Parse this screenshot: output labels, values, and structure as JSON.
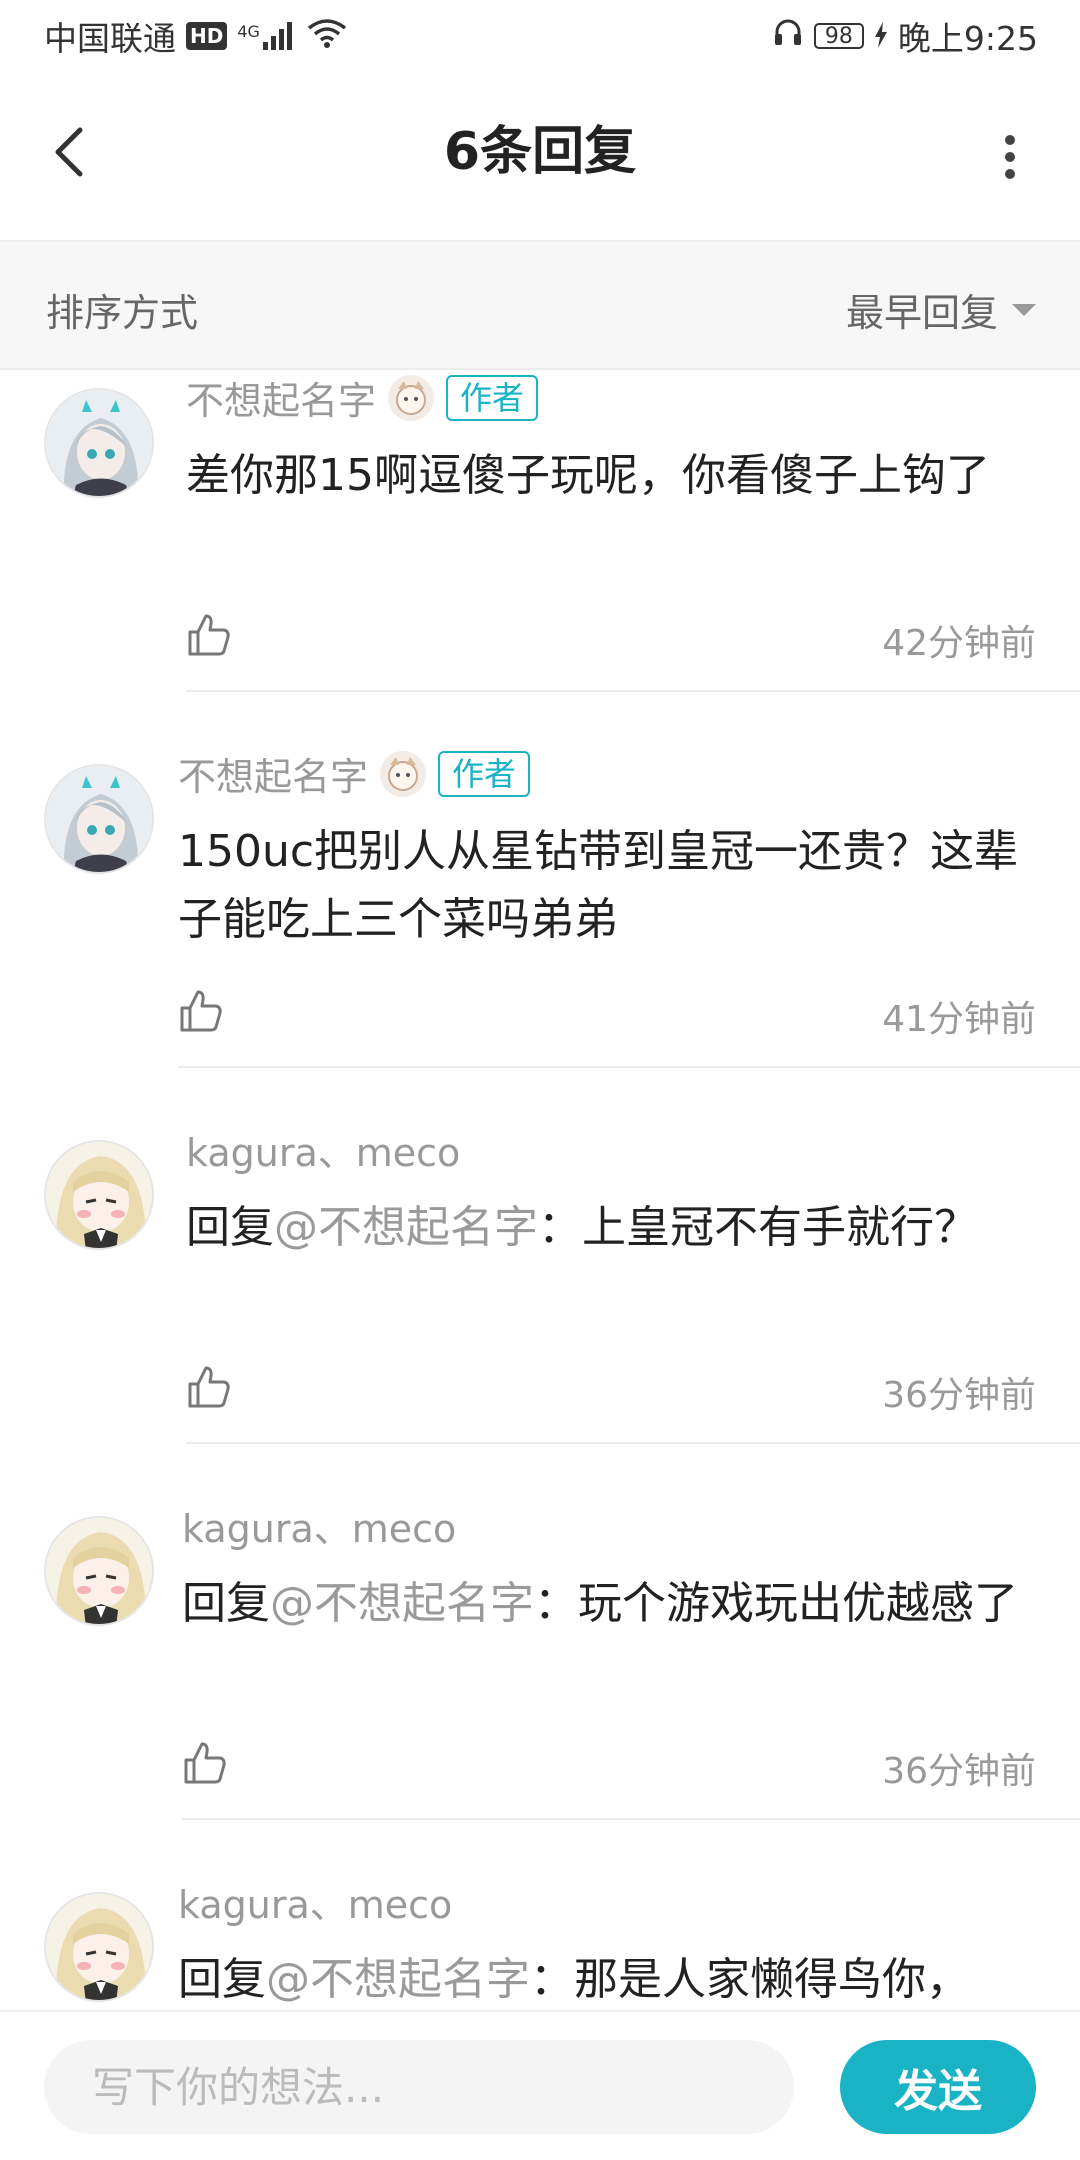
{
  "status_bar": {
    "carrier": "中国联通",
    "hd": "HD",
    "network": "4G",
    "battery": "98",
    "time": "晚上9:25"
  },
  "header": {
    "title": "6条回复",
    "back_icon": "chevron-left-icon",
    "more_icon": "more-vertical-icon"
  },
  "sort": {
    "label": "排序方式",
    "selected": "最早回复"
  },
  "comments": [
    {
      "user": "不想起名字",
      "author_tag": "作者",
      "text": "差你那15啊逗傻子玩呢，你看傻子上钩了",
      "time": "42分钟前"
    },
    {
      "user": "不想起名字",
      "author_tag": "作者",
      "text": "150uc把别人从星钻带到皇冠一还贵？这辈子能吃上三个菜吗弟弟",
      "time": "41分钟前"
    },
    {
      "user": "kagura、meco",
      "prefix": "回复",
      "mention": "@不想起名字",
      "text": "：上皇冠不有手就行？",
      "time": "36分钟前"
    },
    {
      "user": "kagura、meco",
      "prefix": "回复",
      "mention": "@不想起名字",
      "text": "：玩个游戏玩出优越感了",
      "time": "36分钟前"
    },
    {
      "user": "kagura、meco",
      "prefix": "回复",
      "mention": "@不想起名字",
      "text": "：那是人家懒得鸟你，"
    }
  ],
  "bottom": {
    "placeholder": "写下你的想法...",
    "send": "发送"
  },
  "colors": {
    "accent": "#1ab3c5",
    "secondary_text": "#999999",
    "primary_text": "#222222"
  }
}
